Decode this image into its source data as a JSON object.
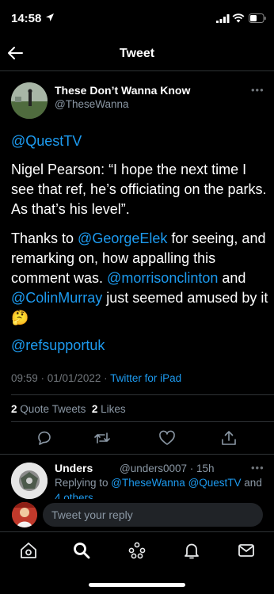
{
  "status_bar": {
    "time": "14:58"
  },
  "header": {
    "title": "Tweet"
  },
  "tweet": {
    "author_name": "These Don’t Wanna Know",
    "author_handle": "@TheseWanna",
    "mention_top": "@QuestTV",
    "para1": "Nigel Pearson: “I hope the next time I see that ref, he’s officiating on the parks. As that’s his level”.",
    "para2_a": "Thanks to ",
    "para2_link1": "@GeorgeElek",
    "para2_b": " for seeing, and remarking on, how appalling this comment was. ",
    "para2_link2": "@morrisonclinton",
    "para2_c": " and ",
    "para2_link3": "@ColinMurray",
    "para2_d": " just seemed amused by it 🤔",
    "mention_bottom": "@refsupportuk",
    "timestamp": "09:59 · 01/01/2022 · ",
    "source": "Twitter for iPad",
    "quote_count": "2",
    "quote_label": "Quote Tweets",
    "like_count": "2",
    "like_label": "Likes"
  },
  "reply": {
    "name": "Unders",
    "handle": "@unders0007 · 15h",
    "replying_to": "Replying to ",
    "link1": "@TheseWanna",
    "link2": "@QuestTV",
    "and_word": " and",
    "others": "4 others"
  },
  "composer": {
    "placeholder": "Tweet your reply"
  },
  "colors": {
    "accent": "#1d9bf0",
    "background": "#000000",
    "secondary_text": "#71767b"
  },
  "icons": {
    "actions": [
      "reply-icon",
      "retweet-icon",
      "like-icon",
      "share-icon"
    ],
    "tabs": [
      "home-icon",
      "search-icon",
      "spaces-icon",
      "notifications-icon",
      "messages-icon"
    ]
  }
}
